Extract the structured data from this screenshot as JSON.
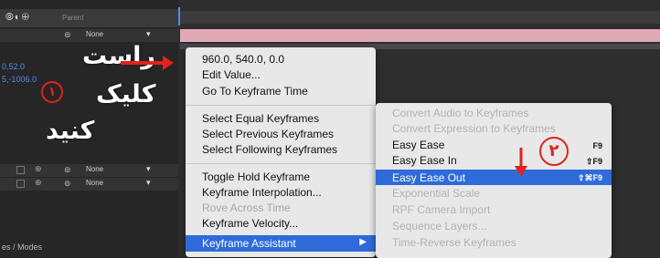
{
  "layer_panel": {
    "header_icons": "⦾◐⊕",
    "header_label": "Parent",
    "rows": [
      {
        "parent_value": "None"
      },
      {
        "parent_value": "None"
      },
      {
        "parent_value": "None"
      }
    ],
    "values": [
      "0,52.0",
      "5,-1006.0"
    ],
    "footer": "es / Modes"
  },
  "annotations": {
    "line1": "راست",
    "line2": "کلیک",
    "line3": "کنید",
    "step1": "۱",
    "step2": "۲",
    "accent_color": "#e0231a"
  },
  "context_menu": {
    "group1": [
      "960.0, 540.0, 0.0",
      "Edit Value...",
      "Go To Keyframe Time"
    ],
    "group2": [
      "Select Equal Keyframes",
      "Select Previous Keyframes",
      "Select Following Keyframes"
    ],
    "group3": [
      {
        "label": "Toggle Hold Keyframe",
        "enabled": true
      },
      {
        "label": "Keyframe Interpolation...",
        "enabled": true
      },
      {
        "label": "Rove Across Time",
        "enabled": false
      },
      {
        "label": "Keyframe Velocity...",
        "enabled": true
      }
    ],
    "highlighted": "Keyframe Assistant",
    "highlight_color": "#2f6bd8"
  },
  "submenu": {
    "items": [
      {
        "label": "Convert Audio to Keyframes",
        "enabled": false,
        "shortcut": ""
      },
      {
        "label": "Convert Expression to Keyframes",
        "enabled": false,
        "shortcut": ""
      },
      {
        "label": "Easy Ease",
        "enabled": true,
        "shortcut": "F9"
      },
      {
        "label": "Easy Ease In",
        "enabled": true,
        "shortcut": "⇧F9"
      },
      {
        "label": "Easy Ease Out",
        "enabled": true,
        "shortcut": "⇧⌘F9",
        "highlighted": true
      },
      {
        "label": "Exponential Scale",
        "enabled": false,
        "shortcut": ""
      },
      {
        "label": "RPF Camera Import",
        "enabled": false,
        "shortcut": ""
      },
      {
        "label": "Sequence Layers...",
        "enabled": false,
        "shortcut": ""
      },
      {
        "label": "Time-Reverse Keyframes",
        "enabled": false,
        "shortcut": ""
      }
    ]
  }
}
